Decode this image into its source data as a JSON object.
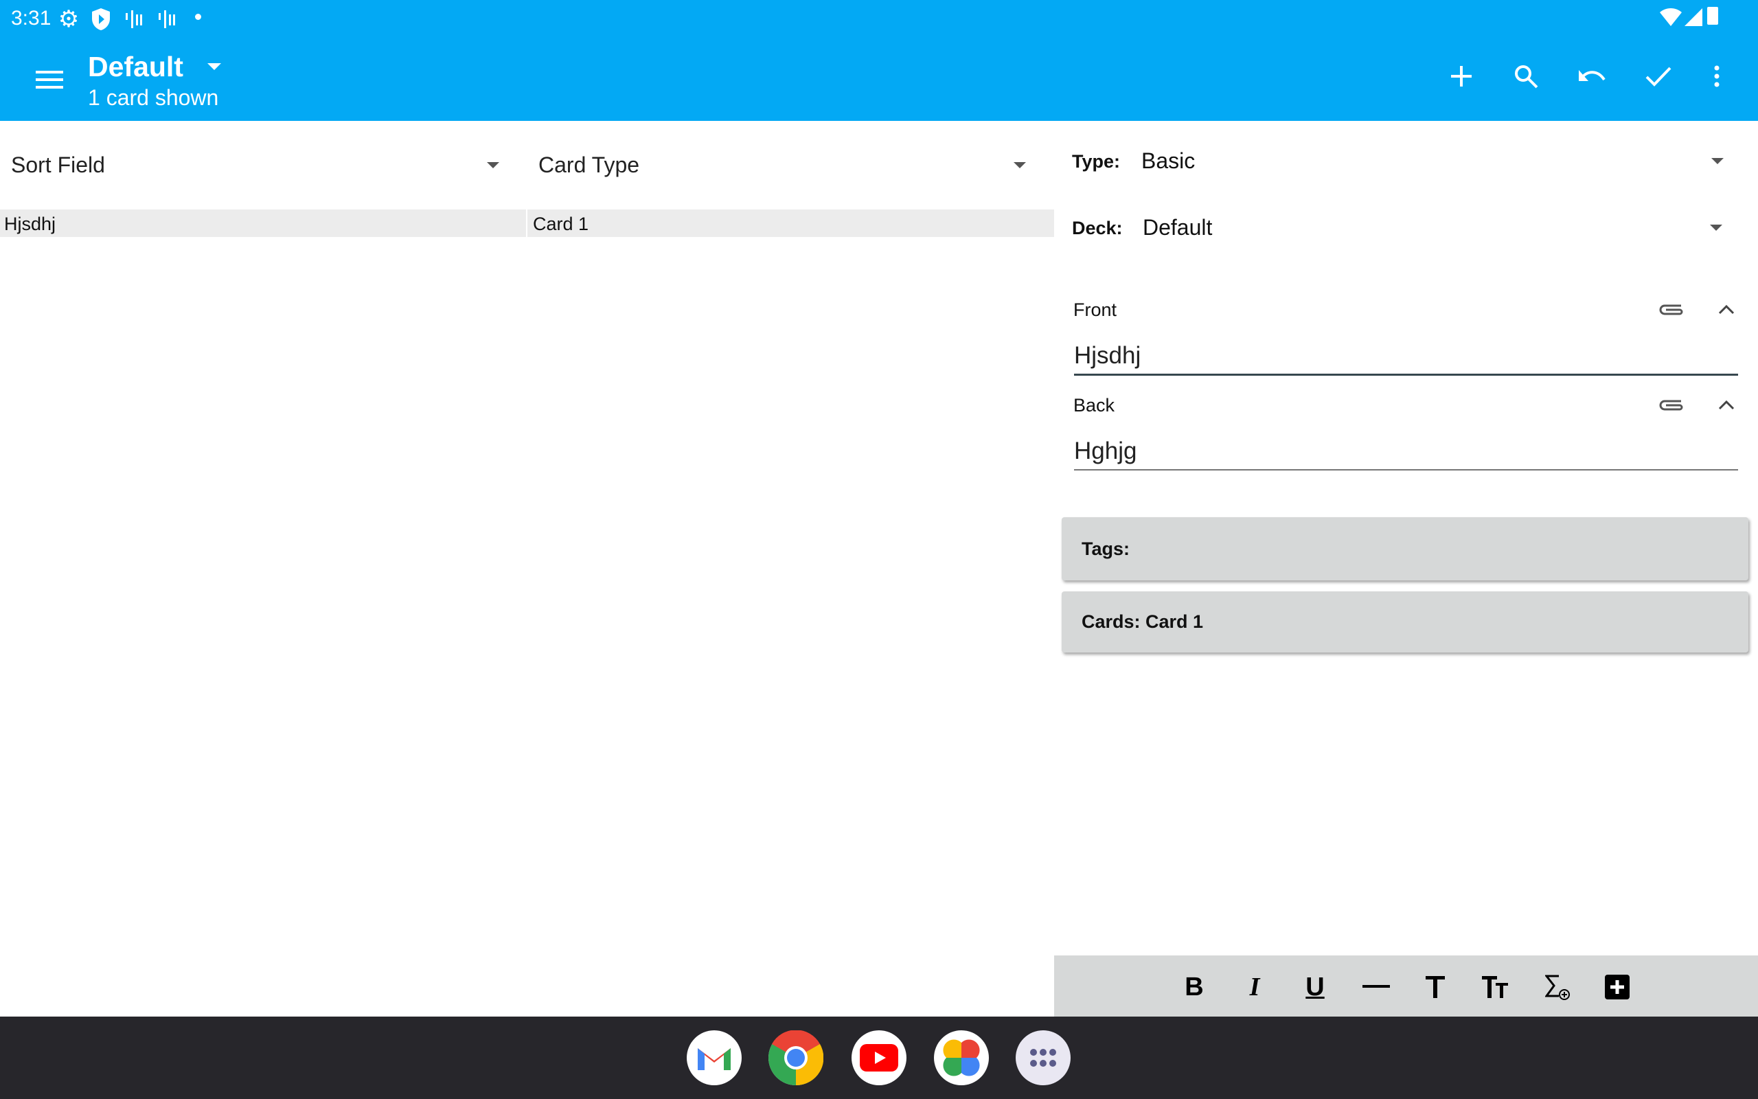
{
  "status": {
    "time": "3:31"
  },
  "appbar": {
    "title": "Default",
    "subtitle": "1 card shown",
    "icons": [
      "menu-icon",
      "add-icon",
      "search-icon",
      "undo-icon",
      "check-icon",
      "more-vert-icon"
    ]
  },
  "browser": {
    "column1": "Sort Field",
    "column2": "Card Type",
    "rows": [
      {
        "sort_field": "Hjsdhj",
        "card_type": "Card 1"
      }
    ]
  },
  "editor": {
    "type_label": "Type:",
    "type_value": "Basic",
    "deck_label": "Deck:",
    "deck_value": "Default",
    "fields": [
      {
        "label": "Front",
        "value": "Hjsdhj"
      },
      {
        "label": "Back",
        "value": "Hghjg"
      }
    ],
    "tags_label": "Tags:",
    "cards_label": "Cards: Card 1"
  },
  "format_toolbar": {
    "bold": "B",
    "italic": "I",
    "underline": "U",
    "icons": [
      "bold-icon",
      "italic-icon",
      "underline-icon",
      "horizontal-rule-icon",
      "text-size-icon",
      "text-case-icon",
      "mathjax-icon",
      "add-custom-button-icon"
    ]
  },
  "dock": [
    "gmail-icon",
    "chrome-icon",
    "youtube-icon",
    "photos-icon",
    "app-drawer-icon"
  ],
  "colors": {
    "accent": "#03A9F4",
    "toolbar": "#d6d8d8",
    "navbar": "#27262b"
  }
}
